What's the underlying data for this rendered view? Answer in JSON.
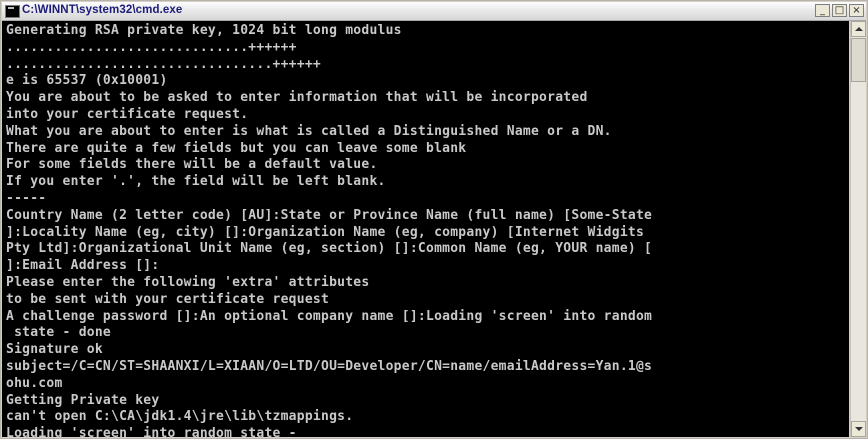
{
  "window": {
    "title": "C:\\WINNT\\system32\\cmd.exe",
    "icon": "cmd-icon",
    "controls": {
      "minimize": "_",
      "maximize": "□",
      "close": "×"
    }
  },
  "console": {
    "text": "Generating RSA private key, 1024 bit long modulus\n..............................++++++\n.................................++++++\ne is 65537 (0x10001)\nYou are about to be asked to enter information that will be incorporated\ninto your certificate request.\nWhat you are about to enter is what is called a Distinguished Name or a DN.\nThere are quite a few fields but you can leave some blank\nFor some fields there will be a default value.\nIf you enter '.', the field will be left blank.\n-----\nCountry Name (2 letter code) [AU]:State or Province Name (full name) [Some-State\n]:Locality Name (eg, city) []:Organization Name (eg, company) [Internet Widgits\nPty Ltd]:Organizational Unit Name (eg, section) []:Common Name (eg, YOUR name) [\n]:Email Address []:\nPlease enter the following 'extra' attributes\nto be sent with your certificate request\nA challenge password []:An optional company name []:Loading 'screen' into random\n state - done\nSignature ok\nsubject=/C=CN/ST=SHAANXI/L=XIAAN/O=LTD/OU=Developer/CN=name/emailAddress=Yan.1@s\nohu.com\nGetting Private key\ncan't open C:\\CA\\jdk1.4\\jre\\lib\\tzmappings.\nLoading 'screen' into random state -"
  },
  "colors": {
    "console_bg": "#000000",
    "console_fg": "#c9c9c9",
    "title_text": "#1c1c7a"
  }
}
